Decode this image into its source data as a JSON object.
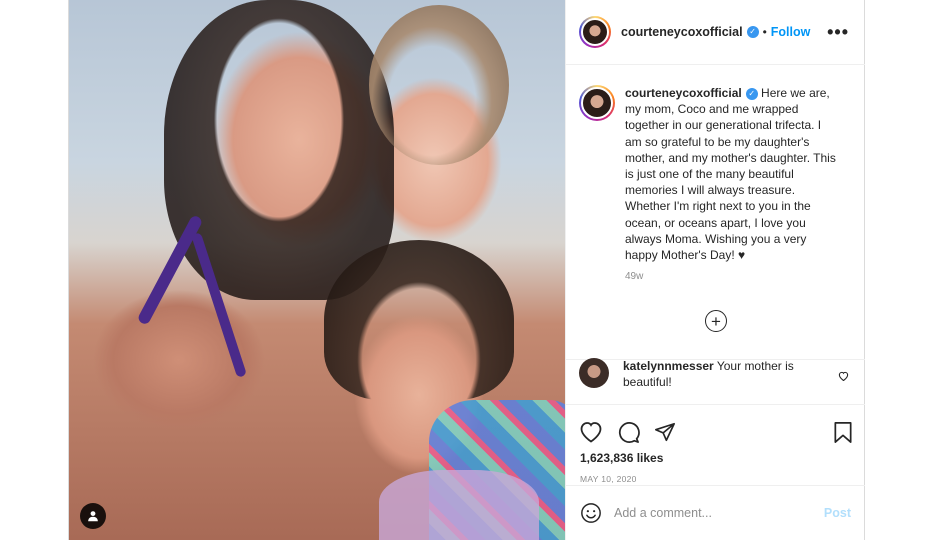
{
  "post": {
    "username": "courteneycoxofficial",
    "follow_label": "Follow",
    "separator": "•",
    "more_icon": "•••",
    "caption": "Here we are, my mom, Coco and me wrapped together in our generational trifecta. I am so grateful to be my daughter's mother, and my mother's daughter. This is just one of the many beautiful memories I will always treasure. Whether I'm right next to you in the ocean, or oceans apart, I love you always Moma. Wishing you a very happy Mother's Day! ♥",
    "time_ago": "49w",
    "load_more_icon": "+",
    "comment": {
      "username": "katelynnmesser",
      "text": "Your mother is beautiful!"
    },
    "likes": "1,623,836 likes",
    "date": "MAY 10, 2020",
    "comment_placeholder": "Add a comment...",
    "post_label": "Post"
  },
  "colors": {
    "accent": "#0095f6",
    "verified": "#3897f0",
    "post_disabled": "#b2dffc",
    "muted": "#8e8e8e"
  }
}
